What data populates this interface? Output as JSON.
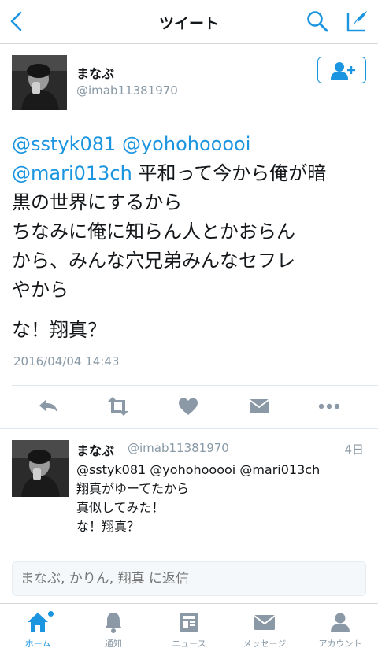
{
  "nav": {
    "title": "ツイート"
  },
  "tweet": {
    "author_name": "まなぶ",
    "author_handle": "@imab11381970",
    "mentions": [
      "@sstyk081",
      "@yohohooooi",
      "@mari013ch"
    ],
    "line1_text": "平和って今から俺が暗",
    "line2": "黒の世界にするから",
    "para2_line1": "ちなみに俺に知らん人とかおらん",
    "para2_line2": "から、みんな穴兄弟みんなセフレ",
    "para2_line3": "やから",
    "para3": "な！翔真？",
    "timestamp": "2016/04/04 14:43"
  },
  "reply": {
    "author_name": "まなぶ",
    "author_handle": "@imab11381970",
    "time": "4日",
    "lines": [
      "@sstyk081 @yohohooooi @mari013ch",
      "翔真がゆーてたから",
      "真似してみた！",
      "な！翔真？"
    ]
  },
  "composer": {
    "placeholder": "まなぶ, かりん, 翔真 に返信"
  },
  "tabbar": {
    "items": [
      {
        "label": "ホーム",
        "icon": "home-icon",
        "active": true
      },
      {
        "label": "通知",
        "icon": "bell-icon"
      },
      {
        "label": "ニュース",
        "icon": "news-icon"
      },
      {
        "label": "メッセージ",
        "icon": "envelope-icon"
      },
      {
        "label": "アカウント",
        "icon": "person-icon"
      }
    ]
  },
  "colors": {
    "accent": "#1b95e0",
    "muted": "#8899a6",
    "icon_gray": "#8b98a5"
  }
}
